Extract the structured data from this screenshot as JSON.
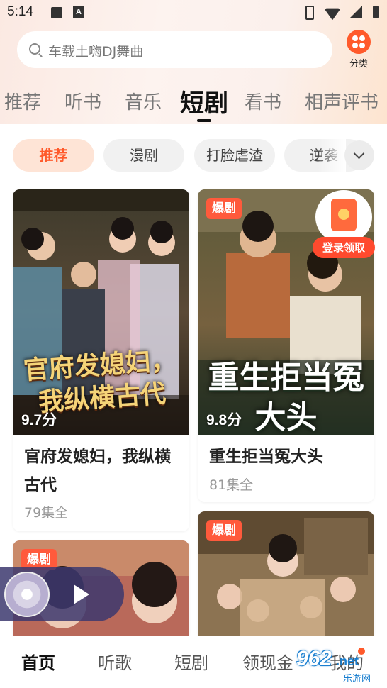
{
  "status_bar": {
    "time": "5:14",
    "ime_label": "A"
  },
  "search": {
    "placeholder": "车载土嗨DJ舞曲"
  },
  "category_button": {
    "label": "分类"
  },
  "tabs": [
    {
      "label": "推荐"
    },
    {
      "label": "听书"
    },
    {
      "label": "音乐"
    },
    {
      "label": "短剧",
      "active": true
    },
    {
      "label": "看书"
    },
    {
      "label": "相声评书"
    }
  ],
  "chips": [
    {
      "label": "推荐",
      "active": true
    },
    {
      "label": "漫剧"
    },
    {
      "label": "打脸虐渣"
    },
    {
      "label": "逆袭"
    }
  ],
  "cards": [
    {
      "title": "官府发媳妇，我纵横古代",
      "score": "9.7分",
      "episodes": "79集全",
      "poster_text": "官府发媳妇，我纵横古代",
      "badge": ""
    },
    {
      "title": "重生拒当冤大头",
      "score": "9.8分",
      "episodes": "81集全",
      "poster_text": "重生拒当冤大头",
      "badge": "爆剧"
    },
    {
      "title": "",
      "badge": "爆剧"
    },
    {
      "title": "",
      "badge": "爆剧"
    }
  ],
  "promo": {
    "label": "登录领取"
  },
  "bottom_nav": [
    {
      "label": "首页",
      "active": true
    },
    {
      "label": "听歌"
    },
    {
      "label": "短剧"
    },
    {
      "label": "领现金"
    },
    {
      "label": "我的"
    }
  ],
  "watermark": {
    "brand": "962",
    "suffix": ".net",
    "site": "乐游网"
  }
}
